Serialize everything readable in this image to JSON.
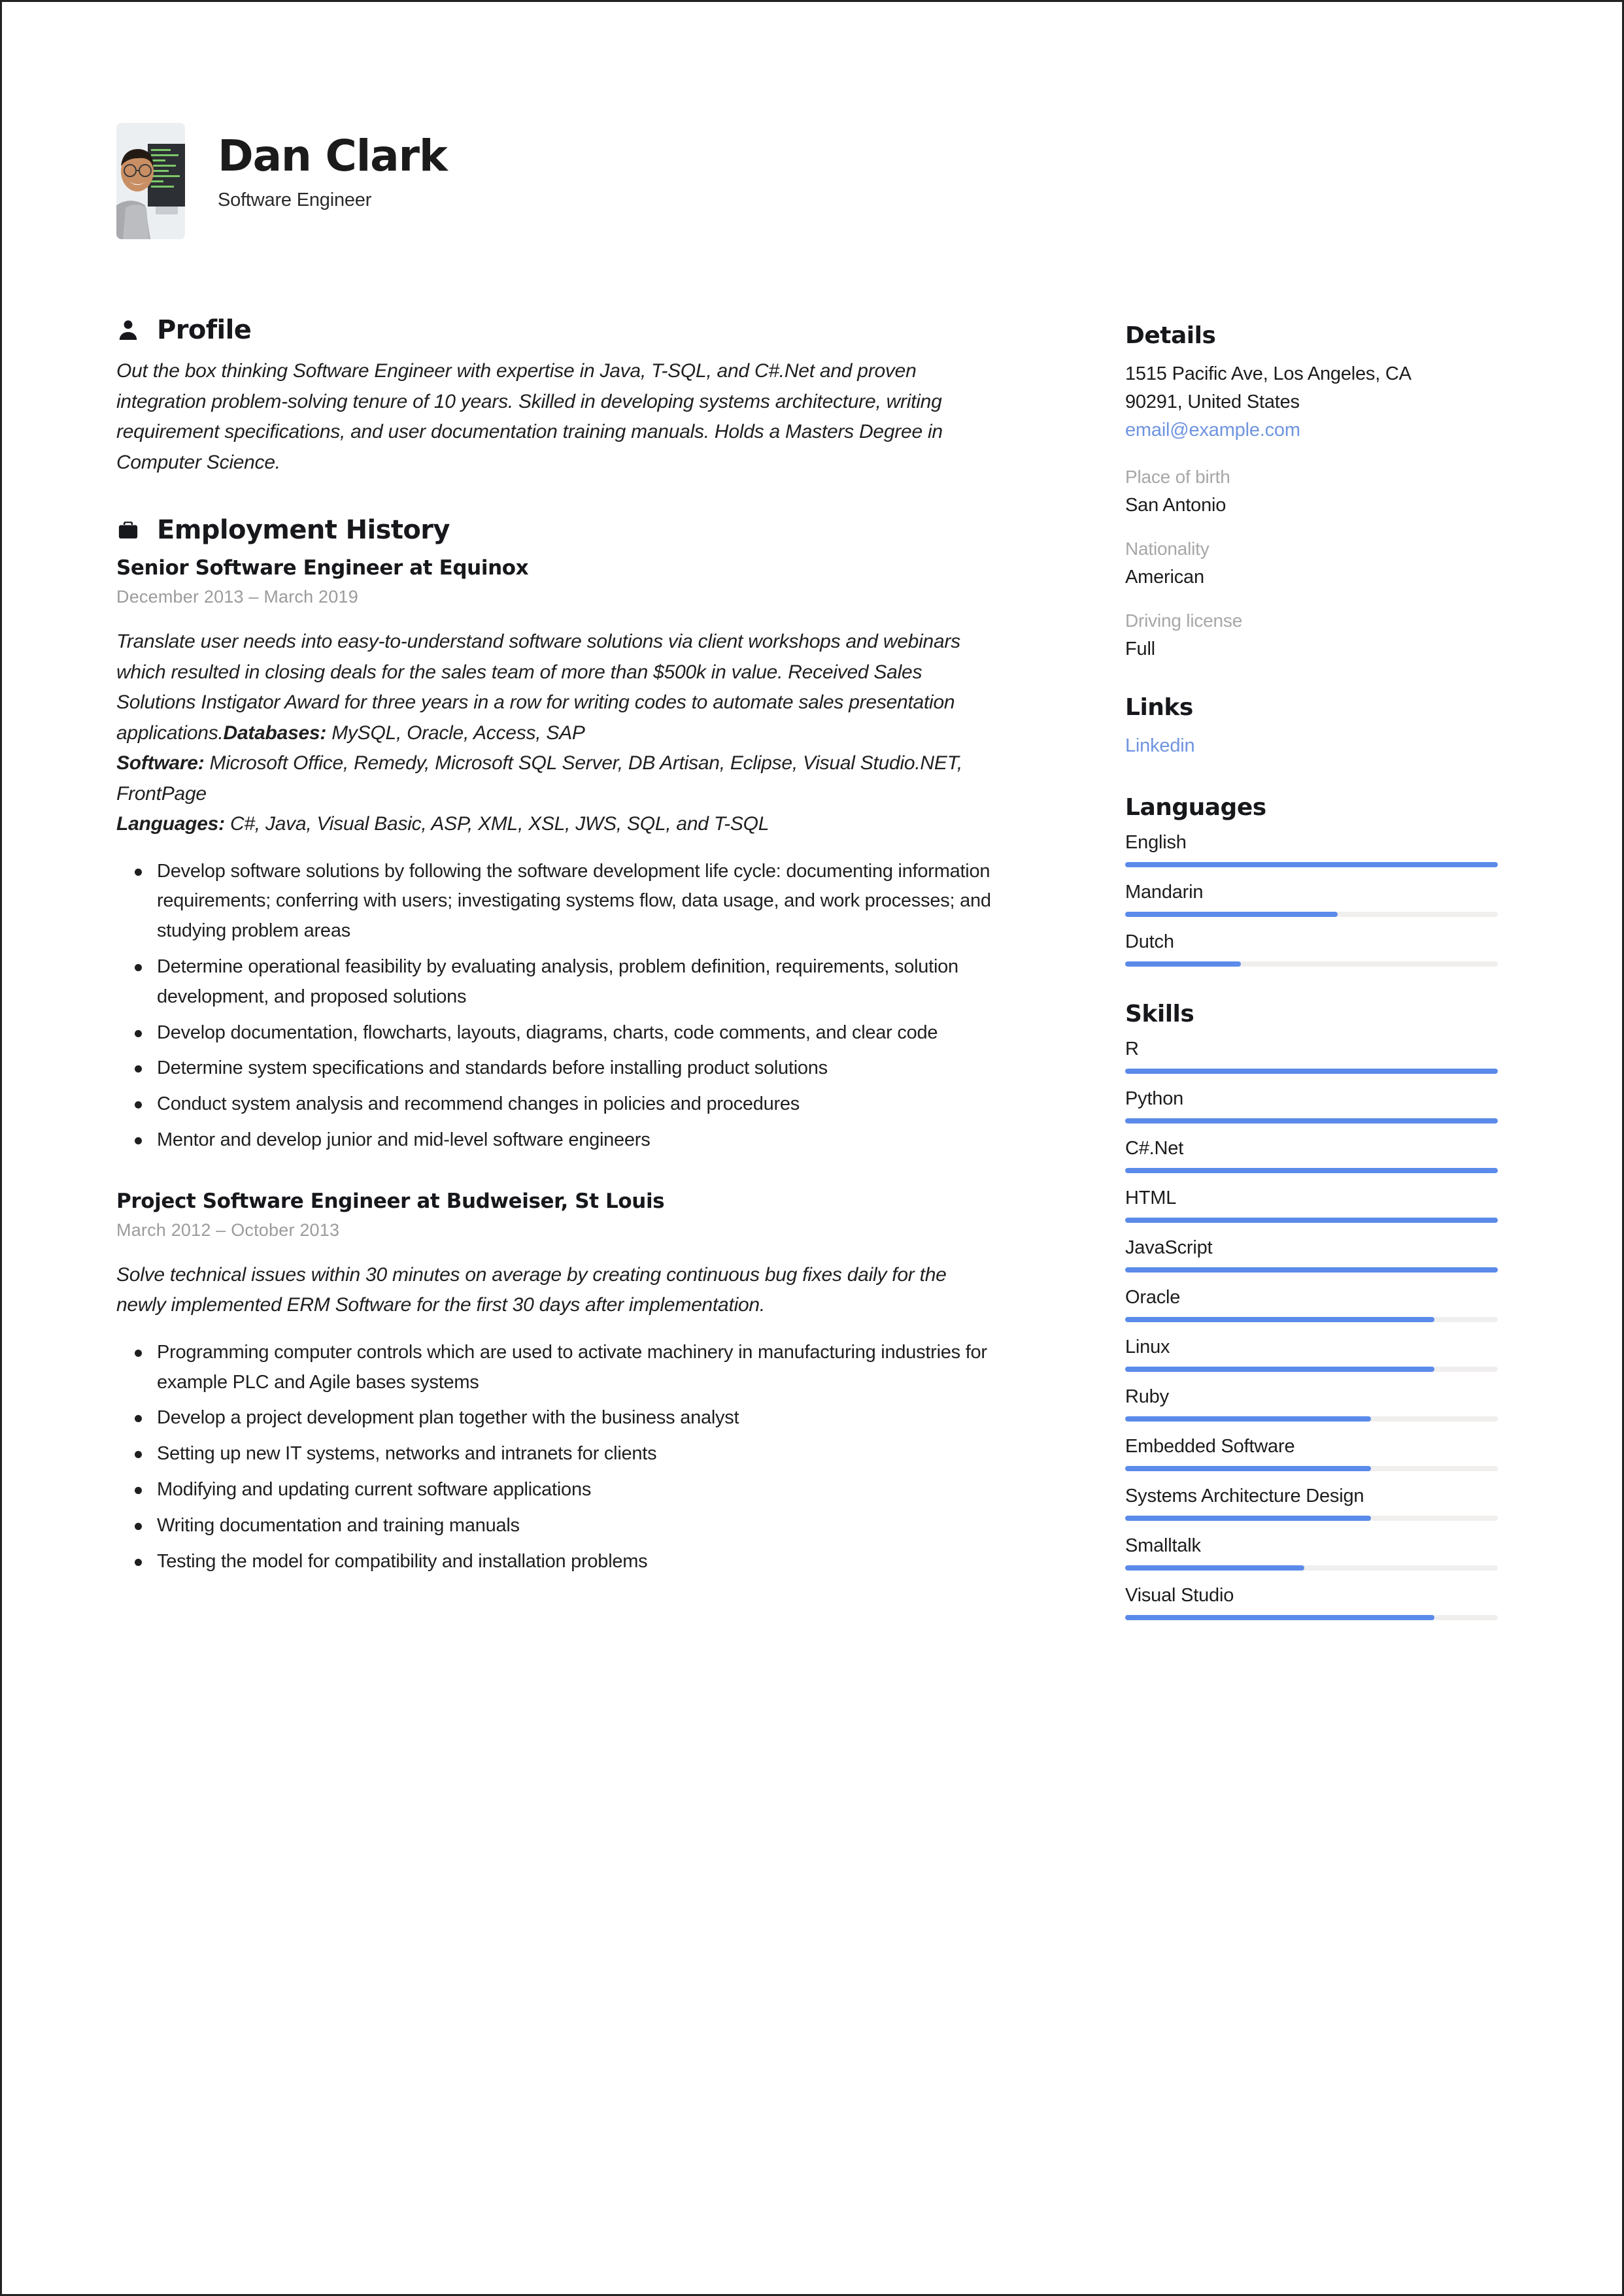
{
  "header": {
    "name": "Dan Clark",
    "title": "Software Engineer",
    "avatar_icon": "portrait-photo"
  },
  "profile": {
    "heading": "Profile",
    "icon": "person-icon",
    "text": "Out the box thinking Software Engineer with expertise in Java, T-SQL, and C#.Net and proven integration problem-solving tenure of 10 years. Skilled in developing systems architecture, writing requirement specifications, and user documentation training manuals. Holds a Masters Degree in Computer Science."
  },
  "employment": {
    "heading": "Employment History",
    "icon": "briefcase-icon",
    "jobs": [
      {
        "role": "Senior Software Engineer at Equinox",
        "dates": "December 2013  –  March 2019",
        "summary_lead": "Translate user needs into easy-to-understand software solutions via client workshops and webinars which resulted in closing deals for the sales team of more than $500k in value. Received  Sales Solutions Instigator Award for three years in a row for writing codes to automate sales presentation applications.",
        "databases_label": "Databases:",
        "databases_value": " MySQL, Oracle, Access, SAP",
        "software_label": "Software:",
        "software_value": " Microsoft Office, Remedy, Microsoft SQL Server, DB Artisan, Eclipse, Visual Studio.NET, FrontPage",
        "languages_label": "Languages:",
        "languages_value": " C#, Java, Visual Basic, ASP, XML, XSL, JWS, SQL, and T-SQL",
        "bullets": [
          "Develop software solutions by following the software development life cycle: documenting information requirements; conferring with users; investigating systems flow, data usage, and work processes; and studying problem areas",
          "Determine operational feasibility by evaluating analysis, problem definition, requirements, solution development, and proposed solutions",
          "Develop documentation, flowcharts, layouts, diagrams, charts, code comments, and clear code",
          "Determine system specifications and standards before installing product solutions",
          "Conduct system analysis and recommend changes in policies and procedures",
          "Mentor and develop junior and mid-level software engineers"
        ]
      },
      {
        "role": "Project Software Engineer at Budweiser, St Louis",
        "dates": "March 2012  –  October 2013",
        "summary_lead": "Solve technical issues within 30 minutes on average by creating continuous bug fixes daily for the newly implemented ERM Software for the first 30 days after implementation.",
        "bullets": [
          "Programming computer controls which are used to activate machinery in manufacturing industries for example PLC and Agile bases systems",
          "Develop a project development plan together with the business analyst",
          "Setting up new IT systems, networks and intranets for clients",
          "Modifying and updating current software applications",
          "Writing documentation and training manuals",
          "Testing the model for compatibility and installation problems"
        ]
      }
    ]
  },
  "details": {
    "heading": "Details",
    "address_line1": "1515 Pacific Ave, Los Angeles, CA",
    "address_line2": "90291, United States",
    "email": "email@example.com",
    "fields": [
      {
        "label": "Place of birth",
        "value": "San Antonio"
      },
      {
        "label": "Nationality",
        "value": "American"
      },
      {
        "label": "Driving license",
        "value": "Full"
      }
    ]
  },
  "links": {
    "heading": "Links",
    "items": [
      {
        "label": "Linkedin"
      }
    ]
  },
  "languages": {
    "heading": "Languages",
    "items": [
      {
        "name": "English",
        "level": 100
      },
      {
        "name": "Mandarin",
        "level": 57
      },
      {
        "name": "Dutch",
        "level": 31
      }
    ]
  },
  "skills": {
    "heading": "Skills",
    "items": [
      {
        "name": "R",
        "level": 100
      },
      {
        "name": "Python",
        "level": 100
      },
      {
        "name": "C#.Net",
        "level": 100
      },
      {
        "name": "HTML",
        "level": 100
      },
      {
        "name": "JavaScript",
        "level": 100
      },
      {
        "name": "Oracle",
        "level": 83
      },
      {
        "name": "Linux",
        "level": 83
      },
      {
        "name": "Ruby",
        "level": 66
      },
      {
        "name": "Embedded Software",
        "level": 66
      },
      {
        "name": "Systems Architecture Design",
        "level": 66
      },
      {
        "name": "Smalltalk",
        "level": 48
      },
      {
        "name": "Visual Studio",
        "level": 83
      }
    ]
  },
  "colors": {
    "accent": "#5b8bea",
    "link": "#6f94e0",
    "track": "#f1eeee",
    "muted": "#a7a7a7",
    "ink": "#17181c"
  }
}
